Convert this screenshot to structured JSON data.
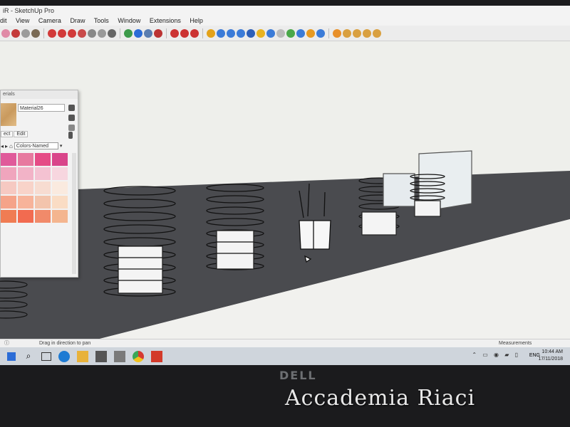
{
  "window": {
    "title": "iR - SketchUp Pro"
  },
  "menu": {
    "items": [
      "dit",
      "View",
      "Camera",
      "Draw",
      "Tools",
      "Window",
      "Extensions",
      "Help"
    ]
  },
  "materials_panel": {
    "header": "erials",
    "material_name": "Material26",
    "tabs": [
      "ect",
      "Edit"
    ],
    "library": "Colors-Named",
    "swatches": [
      "#e05a9a",
      "#e7799f",
      "#e54b86",
      "#d9458a",
      "#f0a5bd",
      "#f2b3c7",
      "#f4c2d2",
      "#f7d6df",
      "#f6c9c2",
      "#f8d3c9",
      "#f7dcd1",
      "#faeadf",
      "#f5a389",
      "#f7b39a",
      "#f3c4ac",
      "#fadcc4",
      "#f07c53",
      "#f26b50",
      "#f18a6a",
      "#f4b58f"
    ]
  },
  "status": {
    "hint": "Drag in direction to pan",
    "measurements_label": "Measurements"
  },
  "taskbar": {
    "lang": "ENG",
    "time": "10:44 AM",
    "date": "17/11/2018"
  },
  "brand": {
    "logo": "DELL"
  },
  "watermark": {
    "text": "Accademia Riaci"
  },
  "colors": {
    "ground": "#4a4b4f",
    "sky": "#eeefeb",
    "accent": "#2b6cd6"
  }
}
